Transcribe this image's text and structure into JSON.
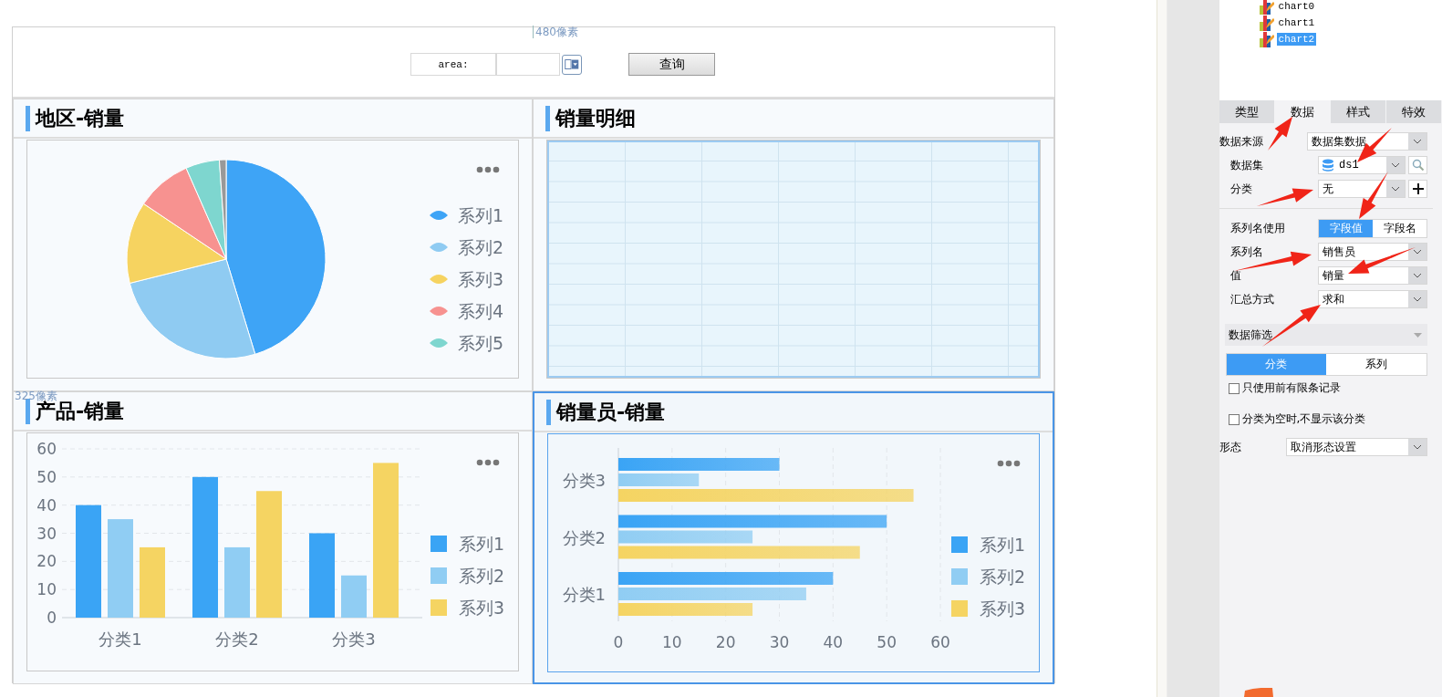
{
  "canvas": {
    "width_marker": "480像素",
    "height_marker": "325像素"
  },
  "query_bar": {
    "label": "area:",
    "button": "查询"
  },
  "panels": [
    {
      "title": "地区-销量",
      "kind": "pie",
      "selected": false,
      "legend": [
        {
          "label": "系列1",
          "color": "#3ea4f6"
        },
        {
          "label": "系列2",
          "color": "#8fcbf2"
        },
        {
          "label": "系列3",
          "color": "#f6d360"
        },
        {
          "label": "系列4",
          "color": "#f79290"
        },
        {
          "label": "系列5",
          "color": "#7ed6cf"
        }
      ]
    },
    {
      "title": "销量明细",
      "kind": "table",
      "selected": false
    },
    {
      "title": "产品-销量",
      "kind": "chart",
      "selected": false,
      "chart_data": {
        "type": "bar",
        "orientation": "vertical",
        "categories": [
          "分类1",
          "分类2",
          "分类3"
        ],
        "series": [
          {
            "name": "系列1",
            "color": "#3aa4f5",
            "values": [
              40,
              50,
              30
            ]
          },
          {
            "name": "系列2",
            "color": "#90cdf3",
            "values": [
              35,
              25,
              15
            ]
          },
          {
            "name": "系列3",
            "color": "#f5d462",
            "values": [
              25,
              45,
              55
            ]
          }
        ],
        "ylim": [
          0,
          60
        ],
        "yticks": [
          0,
          10,
          20,
          30,
          40,
          50,
          60
        ],
        "grid": true,
        "legend": "right"
      }
    },
    {
      "title": "销量员-销量",
      "kind": "chart",
      "selected": true,
      "chart_data": {
        "type": "bar",
        "orientation": "horizontal",
        "categories": [
          "分类3",
          "分类2",
          "分类1"
        ],
        "series": [
          {
            "name": "系列1",
            "color": "#3aa4f5",
            "values": [
              30,
              50,
              40
            ]
          },
          {
            "name": "系列2",
            "color": "#90cdf3",
            "values": [
              15,
              25,
              35
            ]
          },
          {
            "name": "系列3",
            "color": "#f5d462",
            "values": [
              55,
              45,
              25
            ]
          }
        ],
        "xlim": [
          0,
          60
        ],
        "xticks": [
          0,
          10,
          20,
          30,
          40,
          50,
          60
        ],
        "grid": true,
        "legend": "right"
      }
    }
  ],
  "tree": [
    {
      "label": "chart0",
      "selected": false
    },
    {
      "label": "chart1",
      "selected": false
    },
    {
      "label": "chart2",
      "selected": true
    }
  ],
  "property_tabs": [
    {
      "label": "类型",
      "selected": false
    },
    {
      "label": "数据",
      "selected": true
    },
    {
      "label": "样式",
      "selected": false
    },
    {
      "label": "特效",
      "selected": false
    }
  ],
  "fields": [
    {
      "kind": "select",
      "label": "数据来源",
      "value": "数据集数据"
    },
    {
      "kind": "dataset",
      "label": "数据集",
      "value": "ds1"
    },
    {
      "kind": "select_add",
      "label": "分类",
      "value": "无"
    },
    {
      "kind": "toggle",
      "label": "系列名使用",
      "options": [
        {
          "label": "字段值",
          "selected": true
        },
        {
          "label": "字段名",
          "selected": false
        }
      ]
    },
    {
      "kind": "select",
      "label": "系列名",
      "value": "销售员"
    },
    {
      "kind": "select",
      "label": "值",
      "value": "销量"
    },
    {
      "kind": "select",
      "label": "汇总方式",
      "value": "求和"
    }
  ],
  "filter": {
    "title": "数据筛选",
    "tabs": [
      {
        "label": "分类",
        "selected": true
      },
      {
        "label": "系列",
        "selected": false
      }
    ],
    "options": [
      {
        "label": "只使用前有限条记录",
        "checked": false
      },
      {
        "label": "分类为空时,不显示该分类",
        "checked": false
      }
    ]
  },
  "shape": {
    "label": "形态",
    "value": "取消形态设置"
  }
}
